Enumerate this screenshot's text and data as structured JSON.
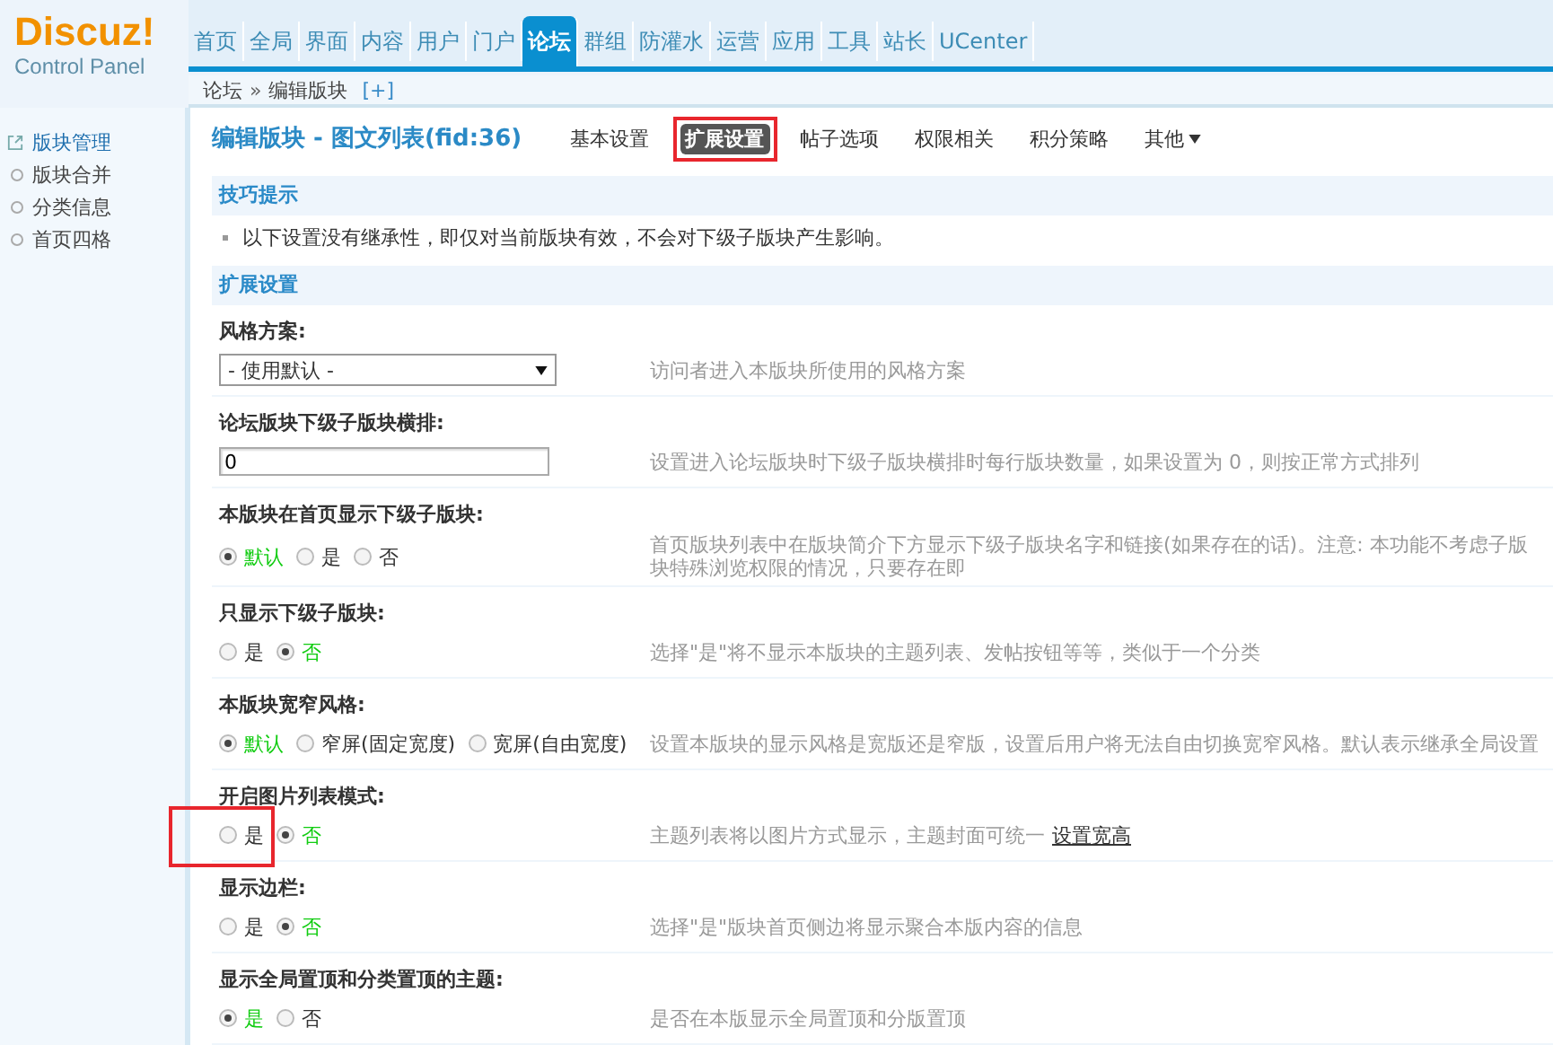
{
  "logo": {
    "title": "Discuz!",
    "subtitle": "Control Panel"
  },
  "nav_tabs": [
    {
      "label": "首页",
      "selected": false
    },
    {
      "label": "全局",
      "selected": false
    },
    {
      "label": "界面",
      "selected": false
    },
    {
      "label": "内容",
      "selected": false
    },
    {
      "label": "用户",
      "selected": false
    },
    {
      "label": "门户",
      "selected": false
    },
    {
      "label": "论坛",
      "selected": true
    },
    {
      "label": "群组",
      "selected": false
    },
    {
      "label": "防灌水",
      "selected": false
    },
    {
      "label": "运营",
      "selected": false
    },
    {
      "label": "应用",
      "selected": false
    },
    {
      "label": "工具",
      "selected": false
    },
    {
      "label": "站长",
      "selected": false
    },
    {
      "label": "UCenter",
      "selected": false
    }
  ],
  "breadcrumb": {
    "items": [
      "论坛",
      "编辑版块"
    ],
    "separator": "»",
    "add": "[+]"
  },
  "sidebar": {
    "items": [
      {
        "label": "版块管理",
        "selected": true
      },
      {
        "label": "版块合并",
        "selected": false
      },
      {
        "label": "分类信息",
        "selected": false
      },
      {
        "label": "首页四格",
        "selected": false
      }
    ]
  },
  "page_title": "编辑版块 - 图文列表(fid:36)",
  "subtabs": [
    {
      "label": "基本设置",
      "selected": false,
      "annotated": false,
      "has_menu": false
    },
    {
      "label": "扩展设置",
      "selected": true,
      "annotated": true,
      "has_menu": false
    },
    {
      "label": "帖子选项",
      "selected": false,
      "annotated": false,
      "has_menu": false
    },
    {
      "label": "权限相关",
      "selected": false,
      "annotated": false,
      "has_menu": false
    },
    {
      "label": "积分策略",
      "selected": false,
      "annotated": false,
      "has_menu": false
    },
    {
      "label": "其他",
      "selected": false,
      "annotated": false,
      "has_menu": true
    }
  ],
  "tips": {
    "title": "技巧提示",
    "items": [
      "以下设置没有继承性，即仅对当前版块有效，不会对下级子版块产生影响。"
    ]
  },
  "settings": {
    "title": "扩展设置",
    "rows": [
      {
        "label": "风格方案:",
        "kind": "select",
        "value": "- 使用默认 -",
        "description": "访问者进入本版块所使用的风格方案",
        "annotated": false
      },
      {
        "label": "论坛版块下级子版块横排:",
        "kind": "text",
        "value": "0",
        "description": "设置进入论坛版块时下级子版块横排时每行版块数量，如果设置为 0，则按正常方式排列",
        "annotated": false
      },
      {
        "label": "本版块在首页显示下级子版块:",
        "kind": "radio",
        "options": [
          {
            "label": "默认",
            "selected": true
          },
          {
            "label": "是",
            "selected": false
          },
          {
            "label": "否",
            "selected": false
          }
        ],
        "description": "首页版块列表中在版块简介下方显示下级子版块名字和链接(如果存在的话)。注意: 本功能不考虑子版块特殊浏览权限的情况，只要存在即",
        "annotated": false
      },
      {
        "label": "只显示下级子版块:",
        "kind": "radio",
        "options": [
          {
            "label": "是",
            "selected": false
          },
          {
            "label": "否",
            "selected": true
          }
        ],
        "description": "选择\"是\"将不显示本版块的主题列表、发帖按钮等等，类似于一个分类",
        "annotated": false
      },
      {
        "label": "本版块宽窄风格:",
        "kind": "radio",
        "options": [
          {
            "label": "默认",
            "selected": true
          },
          {
            "label": "窄屏(固定宽度)",
            "selected": false
          },
          {
            "label": "宽屏(自由宽度)",
            "selected": false
          }
        ],
        "description": "设置本版块的显示风格是宽版还是窄版，设置后用户将无法自由切换宽窄风格。默认表示继承全局设置",
        "annotated": false
      },
      {
        "label": "开启图片列表模式:",
        "kind": "radio",
        "options": [
          {
            "label": "是",
            "selected": false
          },
          {
            "label": "否",
            "selected": true
          }
        ],
        "description": "主题列表将以图片方式显示，主题封面可统一",
        "link": "设置宽高",
        "annotated": true
      },
      {
        "label": "显示边栏:",
        "kind": "radio",
        "options": [
          {
            "label": "是",
            "selected": false
          },
          {
            "label": "否",
            "selected": true
          }
        ],
        "description": "选择\"是\"版块首页侧边将显示聚合本版内容的信息",
        "annotated": false
      },
      {
        "label": "显示全局置顶和分类置顶的主题:",
        "kind": "radio",
        "options": [
          {
            "label": "是",
            "selected": true
          },
          {
            "label": "否",
            "selected": false
          }
        ],
        "description": "是否在本版显示全局置顶和分版置顶",
        "annotated": false
      }
    ]
  }
}
